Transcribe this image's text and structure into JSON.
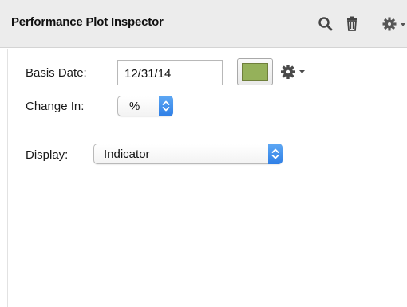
{
  "header": {
    "title": "Performance Plot Inspector",
    "icons": [
      "search-icon",
      "trash-icon",
      "gear-icon"
    ]
  },
  "form": {
    "basis_date_label": "Basis Date:",
    "basis_date_value": "12/31/14",
    "change_in_label": "Change In:",
    "change_in_value": "%",
    "display_label": "Display:",
    "display_value": "Indicator"
  },
  "colors": {
    "swatch": "#95b15a",
    "accent": "#3b8ff0",
    "header_bg": "#ececec"
  }
}
